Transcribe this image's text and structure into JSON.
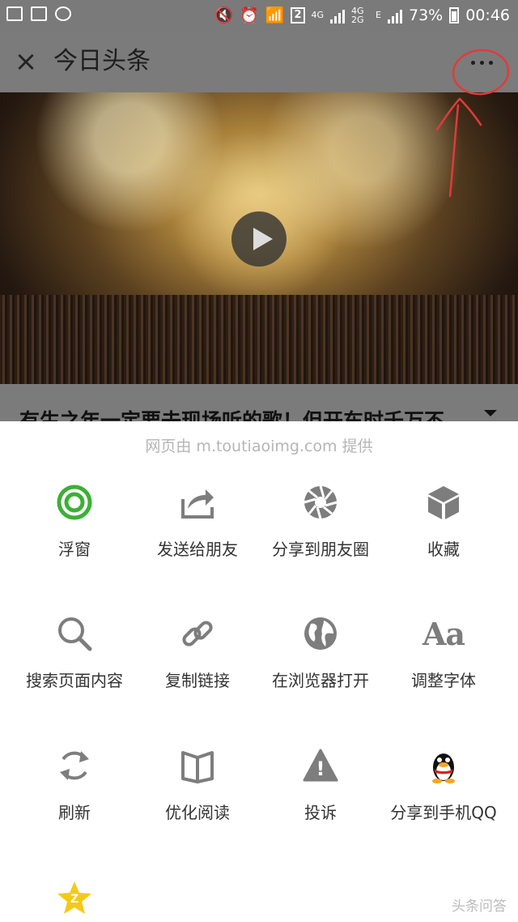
{
  "status_bar": {
    "sim_badge": "2",
    "net_4g": "4G",
    "net_4g2g": "4G 2G",
    "net_e": "E",
    "battery": "73%",
    "time": "00:46",
    "icons": [
      "image-icon",
      "image-icon",
      "people-icon",
      "mute-icon",
      "alarm-icon",
      "wifi-icon",
      "signal-icon",
      "battery-icon"
    ]
  },
  "header": {
    "close_icon": "×",
    "title": "今日头条",
    "annotation_color": "#e23a3a"
  },
  "video": {
    "play_icon": "play-icon"
  },
  "article": {
    "headline": "有生之年一定要去现场听的歌！但开车时千万不"
  },
  "sheet": {
    "provider": "网页由 m.toutiaoimg.com 提供",
    "items": [
      {
        "label": "浮窗",
        "icon": "float-window-icon"
      },
      {
        "label": "发送给朋友",
        "icon": "share-arrow-icon"
      },
      {
        "label": "分享到朋友圈",
        "icon": "moments-icon"
      },
      {
        "label": "收藏",
        "icon": "favorite-cube-icon"
      },
      {
        "label": "搜索页面内容",
        "icon": "search-icon"
      },
      {
        "label": "复制链接",
        "icon": "link-icon"
      },
      {
        "label": "在浏览器打开",
        "icon": "globe-icon"
      },
      {
        "label": "调整字体",
        "icon": "font-size-icon",
        "glyph": "Aa"
      },
      {
        "label": "刷新",
        "icon": "refresh-icon"
      },
      {
        "label": "优化阅读",
        "icon": "book-icon"
      },
      {
        "label": "投诉",
        "icon": "warning-icon",
        "glyph": "!"
      },
      {
        "label": "分享到手机QQ",
        "icon": "qq-penguin-icon"
      },
      {
        "label": "",
        "icon": "qzone-star-icon",
        "glyph": "Z"
      }
    ]
  },
  "colors": {
    "accent_green": "#3cb035",
    "icon_gray": "#7d7d7d",
    "qzone_yellow": "#f6c916"
  },
  "watermark": "头条问答"
}
